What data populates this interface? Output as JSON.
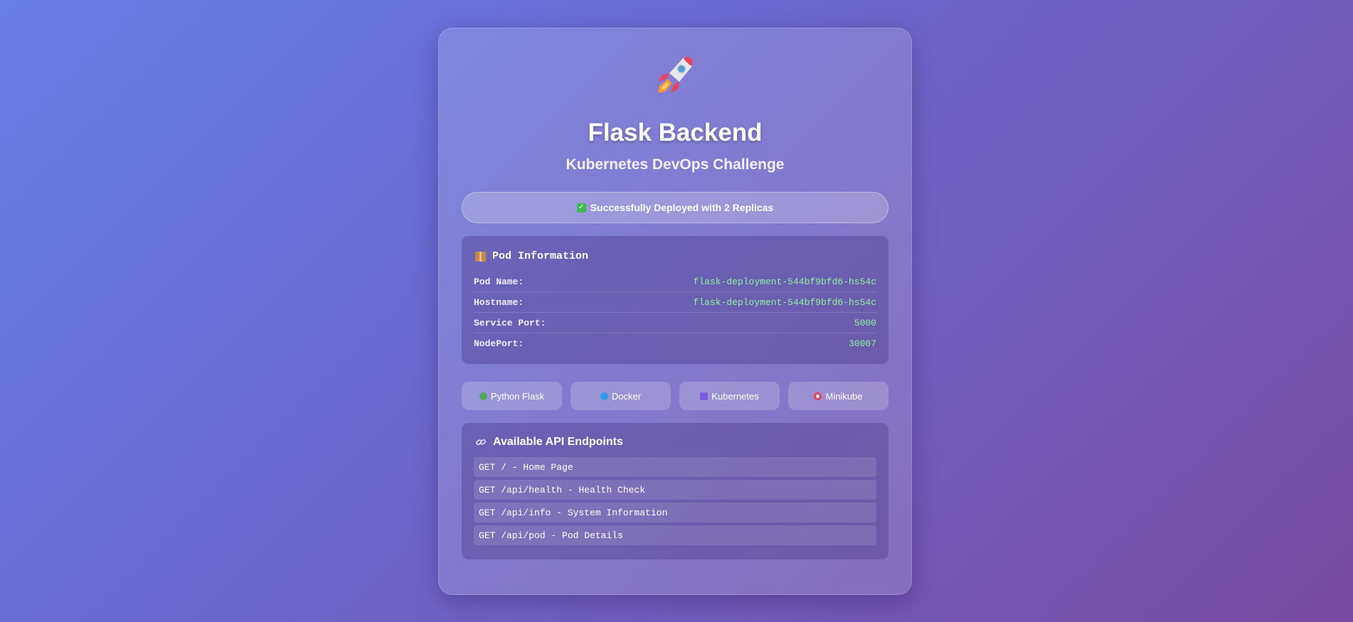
{
  "header": {
    "icon": "rocket-icon",
    "title": "Flask Backend",
    "subtitle": "Kubernetes DevOps Challenge"
  },
  "status": {
    "icon": "check-icon",
    "text": "Successfully Deployed with 2 Replicas"
  },
  "pod_info": {
    "icon": "package-icon",
    "heading": "Pod Information",
    "rows": [
      {
        "label": "Pod Name:",
        "value": "flask-deployment-544bf9bfd6-hs54c"
      },
      {
        "label": "Hostname:",
        "value": "flask-deployment-544bf9bfd6-hs54c"
      },
      {
        "label": "Service Port:",
        "value": "5000"
      },
      {
        "label": "NodePort:",
        "value": "30007"
      }
    ]
  },
  "tech_stack": [
    {
      "icon": "python-icon",
      "label": "Python Flask",
      "color": "#4fa85a"
    },
    {
      "icon": "docker-icon",
      "label": "Docker",
      "color": "#2b9fe6"
    },
    {
      "icon": "kubernetes-icon",
      "label": "Kubernetes",
      "color": "#7b5ce0"
    },
    {
      "icon": "minikube-icon",
      "label": "Minikube",
      "color": "#e0455a"
    }
  ],
  "api": {
    "icon": "link-icon",
    "heading": "Available API Endpoints",
    "endpoints": [
      "GET / - Home Page",
      "GET /api/health - Health Check",
      "GET /api/info - System Information",
      "GET /api/pod - Pod Details"
    ]
  },
  "colors": {
    "gradient_start": "#667eea",
    "gradient_end": "#764ba2",
    "value_green": "#8ff0a4"
  }
}
